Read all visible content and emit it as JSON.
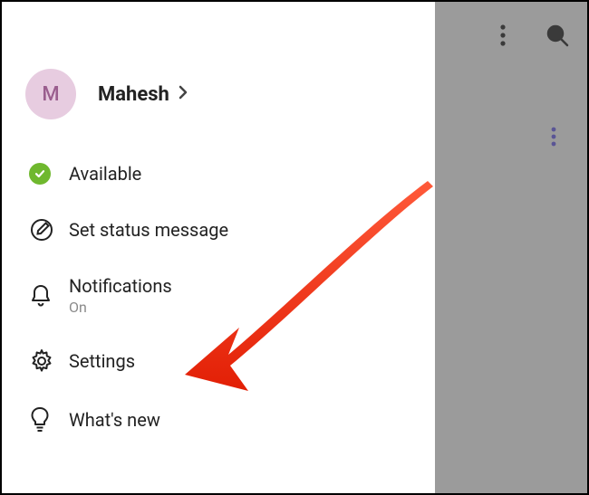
{
  "profile": {
    "initial": "M",
    "name": "Mahesh"
  },
  "menu": {
    "status": {
      "label": "Available"
    },
    "set_status": {
      "label": "Set status message"
    },
    "notifications": {
      "label": "Notifications",
      "sub": "On"
    },
    "settings": {
      "label": "Settings"
    },
    "whats_new": {
      "label": "What's new"
    }
  },
  "colors": {
    "avatar_bg": "#e7cce0",
    "avatar_fg": "#9a5e8e",
    "presence": "#6fb82e",
    "arrow": "#f23a1f"
  }
}
